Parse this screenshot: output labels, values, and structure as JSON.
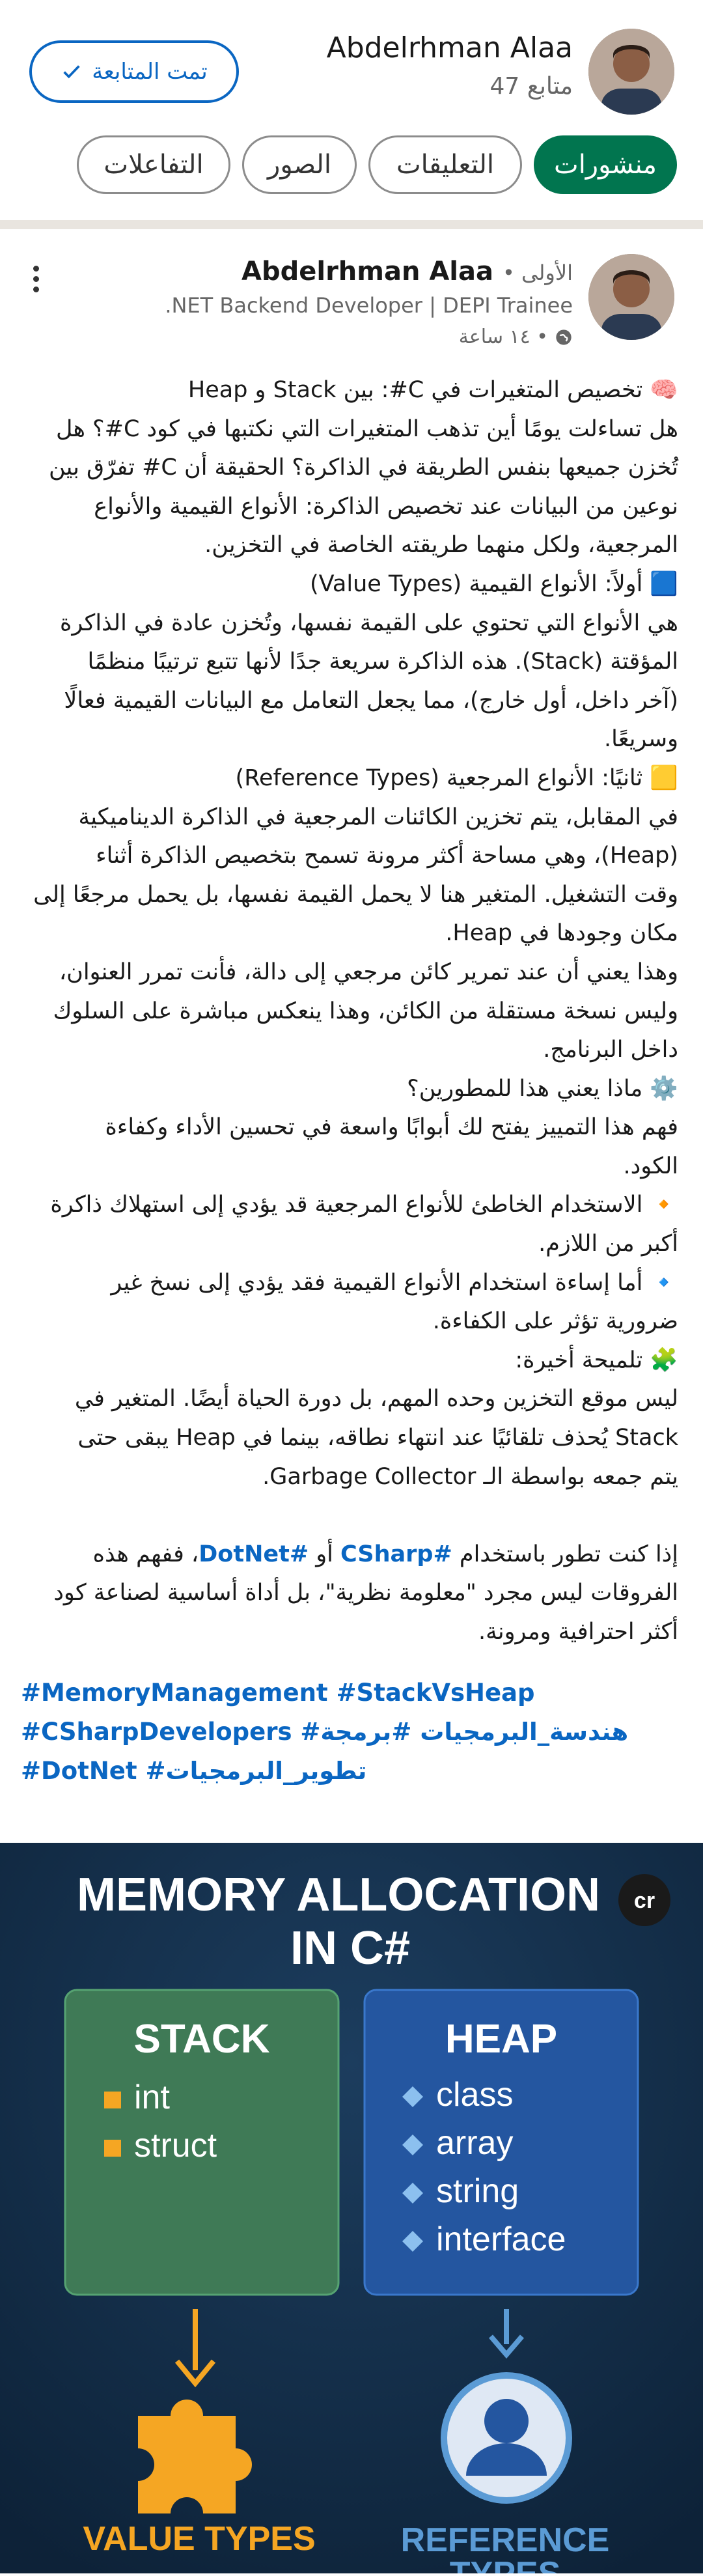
{
  "profile": {
    "name": "Abdelrhman Alaa",
    "followers": "47 متابع",
    "follow_label": "تمت المتابعة"
  },
  "tabs": [
    {
      "label": "منشورات",
      "active": true
    },
    {
      "label": "التعليقات",
      "active": false
    },
    {
      "label": "الصور",
      "active": false
    },
    {
      "label": "التفاعلات",
      "active": false
    }
  ],
  "post": {
    "author": "Abdelrhman Alaa",
    "degree": "• الأولى",
    "headline": ".NET Backend Developer | DEPI Trainee",
    "time": "١٤ ساعة •",
    "lines": [
      "🧠 تخصيص المتغيرات في C#: بين Stack و Heap",
      "هل تساءلت يومًا أين تذهب المتغيرات التي نكتبها في كود C#؟ هل",
      "تُخزن جميعها بنفس الطريقة في الذاكرة؟ الحقيقة أن C# تفرّق بين",
      "نوعين من البيانات عند تخصيص الذاكرة: الأنواع القيمية والأنواع",
      "المرجعية، ولكل منهما طريقته الخاصة في التخزين.",
      "🟦 أولاً: الأنواع القيمية (Value Types)",
      "هي الأنواع التي تحتوي على القيمة نفسها، وتُخزن عادة في الذاكرة",
      "المؤقتة (Stack). هذه الذاكرة سريعة جدًا لأنها تتبع ترتيبًا منظمًا",
      "(آخر داخل، أول خارج)، مما يجعل التعامل مع البيانات القيمية فعالًا",
      "وسريعًا.",
      "🟨 ثانيًا: الأنواع المرجعية (Reference Types)",
      "في المقابل، يتم تخزين الكائنات المرجعية في الذاكرة الديناميكية",
      "(Heap)، وهي مساحة أكثر مرونة تسمح بتخصيص الذاكرة أثناء",
      "وقت التشغيل. المتغير هنا لا يحمل القيمة نفسها، بل يحمل مرجعًا إلى",
      "مكان وجودها في Heap.",
      "وهذا يعني أن عند تمرير كائن مرجعي إلى دالة، فأنت تمرر العنوان،",
      "وليس نسخة مستقلة من الكائن، وهذا ينعكس مباشرة على السلوك",
      "داخل البرنامج.",
      "⚙️ ماذا يعني هذا للمطورين؟",
      "فهم هذا التمييز يفتح لك أبوابًا واسعة في تحسين الأداء وكفاءة",
      "الكود.",
      "🔸 الاستخدام الخاطئ للأنواع المرجعية قد يؤدي إلى استهلاك ذاكرة",
      "أكبر من اللازم.",
      "🔹 أما إساءة استخدام الأنواع القيمية فقد يؤدي إلى نسخ غير",
      "ضرورية تؤثر على الكفاءة.",
      "🧩 تلميحة أخيرة:",
      "ليس موقع التخزين وحده المهم، بل دورة الحياة أيضًا. المتغير في",
      "Stack يُحذف تلقائيًا عند انتهاء نطاقه، بينما في Heap يبقى حتى",
      "يتم جمعه بواسطة الـ Garbage Collector.",
      "",
      "إذا كنت تطور باستخدام #CSharp أو #DotNet، ففهم هذه",
      "الفروقات ليس مجرد \"معلومة نظرية\"، بل أداة أساسية لصناعة كود",
      "أكثر احترافية ومرونة."
    ],
    "hashtag_rows": [
      "#MemoryManagement #StackVsHeap",
      "#CSharpDevelopers #هندسة_البرمجيات #برمجة",
      "#DotNet #تطوير_البرمجيات"
    ]
  },
  "hero": {
    "title_line1": "MEMORY ALLOCATION",
    "title_line2": "IN C#",
    "logo": "cr",
    "stack": {
      "title": "STACK",
      "items": [
        "int",
        "struct"
      ],
      "footer": "VALUE TYPES"
    },
    "heap": {
      "title": "HEAP",
      "items": [
        "class",
        "array",
        "string",
        "interface"
      ],
      "footer_line1": "REFERENCE",
      "footer_line2": "TYPES"
    },
    "colors": {
      "bg": "#102a43",
      "stack": "#3f7a56",
      "heap": "#2456a0",
      "orange": "#f5a623",
      "blue": "#5b9bd5"
    }
  }
}
